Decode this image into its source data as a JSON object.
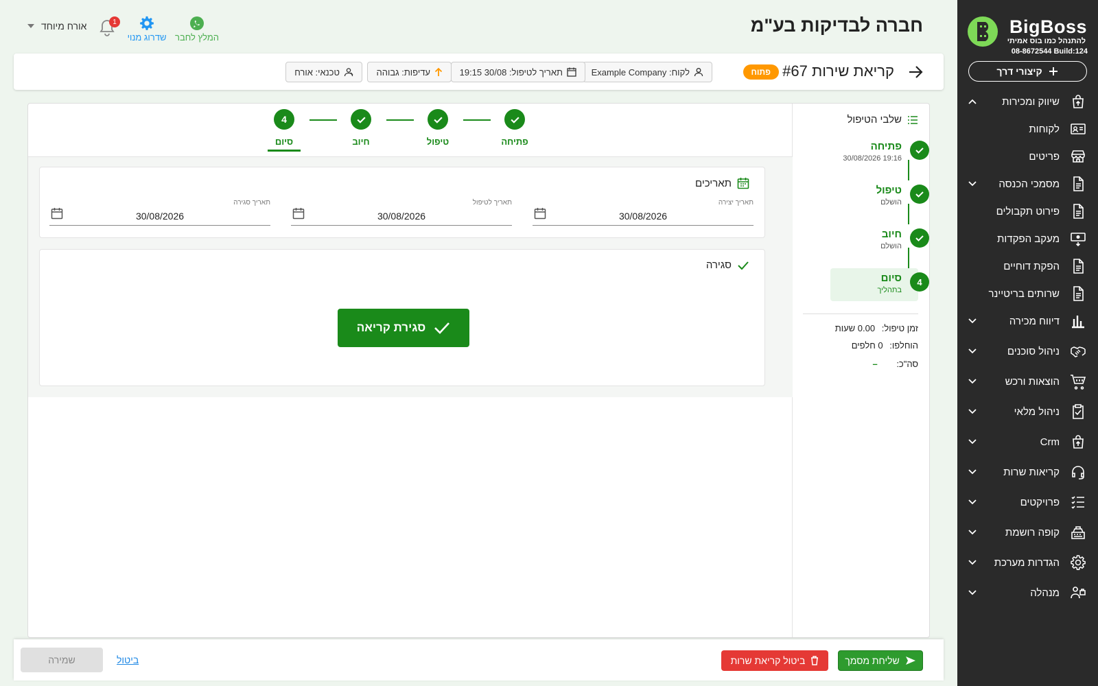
{
  "header": {
    "company_title": "חברה לבדיקות בע\"מ",
    "user_name": "אורח מיוחד",
    "notifications_count": "1",
    "upgrade_label": "שדרוג מנוי",
    "recommend_label": "המלץ לחבר"
  },
  "sidebar": {
    "logo_name": "BigBoss",
    "logo_slogan": "להתנהל כמו בוס אמיתי",
    "logo_phone_build": "08-8672544 Build:124",
    "shortcut_label": "קיצורי דרך",
    "items": [
      {
        "label": "שיווק ומכירות",
        "icon": "bag-upload-icon",
        "chevron": "up"
      },
      {
        "label": "לקוחות",
        "icon": "contact-card-icon",
        "chevron": ""
      },
      {
        "label": "פריטים",
        "icon": "store-icon",
        "chevron": ""
      },
      {
        "label": "מסמכי הכנסה",
        "icon": "document-icon",
        "chevron": "down"
      },
      {
        "label": "פירוט תקבולים",
        "icon": "document-icon",
        "chevron": ""
      },
      {
        "label": "מעקב הפקדות",
        "icon": "cash-deposit-icon",
        "chevron": ""
      },
      {
        "label": "הפקת דוחיים",
        "icon": "document-icon",
        "chevron": ""
      },
      {
        "label": "שרותים בריטיינר",
        "icon": "document-icon",
        "chevron": ""
      },
      {
        "label": "דיווח מכירה",
        "icon": "bar-chart-icon",
        "chevron": "down"
      },
      {
        "label": "ניהול סוכנים",
        "icon": "handshake-icon",
        "chevron": "down"
      },
      {
        "label": "הוצאות ורכש",
        "icon": "cart-icon",
        "chevron": "down"
      },
      {
        "label": "ניהול מלאי",
        "icon": "clipboard-check-icon",
        "chevron": "down"
      },
      {
        "label": "Crm",
        "icon": "bag-upload-icon",
        "chevron": "down"
      },
      {
        "label": "קריאות שרות",
        "icon": "headset-icon",
        "chevron": "down"
      },
      {
        "label": "פרויקטים",
        "icon": "checklist-icon",
        "chevron": "down"
      },
      {
        "label": "קופה רושמת",
        "icon": "cash-register-icon",
        "chevron": "down"
      },
      {
        "label": "הגדרות מערכת",
        "icon": "gear-icon",
        "chevron": "down"
      },
      {
        "label": "מנהלה",
        "icon": "admin-icon",
        "chevron": "down"
      }
    ]
  },
  "call": {
    "title": "קריאת שירות #67",
    "status": "פתוח",
    "customer_chip": "לקוח: Example Company",
    "treatment_date_chip": "תאריך לטיפול: 30/08 19:15",
    "priority_chip": "עדיפות: גבוהה",
    "technician_chip": "טכנאי: אורח"
  },
  "steps_panel": {
    "title": "שלבי הטיפול",
    "steps": [
      {
        "name": "פתיחה",
        "sub": "30/08/2026 19:16",
        "circle": ""
      },
      {
        "name": "טיפול",
        "sub": "הושלם",
        "circle": ""
      },
      {
        "name": "חיוב",
        "sub": "הושלם",
        "circle": ""
      },
      {
        "name": "סיום",
        "sub": "בתהליך",
        "circle": "4"
      }
    ],
    "summary": {
      "time_label": "זמן טיפול:",
      "time_value": "0.00 שעות",
      "parts_label": "הוחלפו:",
      "parts_value": "0 חלפים",
      "total_label": "סה\"כ:",
      "total_value": "–"
    }
  },
  "stepper": {
    "steps": [
      {
        "label": "פתיחה",
        "circle": ""
      },
      {
        "label": "טיפול",
        "circle": ""
      },
      {
        "label": "חיוב",
        "circle": ""
      },
      {
        "label": "סיום",
        "circle": "4"
      }
    ]
  },
  "dates": {
    "title": "תאריכים",
    "created_label": "תאריך יצירה",
    "created_value": "30/08/2026",
    "treatment_label": "תאריך לטיפול",
    "treatment_value": "30/08/2026",
    "closing_label": "תאריך סגירה",
    "closing_value": "30/08/2026"
  },
  "closing": {
    "title": "סגירה",
    "close_button": "סגירת קריאה"
  },
  "footer": {
    "send_doc": "שליחת מסמך",
    "cancel_call": "ביטול קריאת שרות",
    "cancel": "ביטול",
    "save": "שמירה"
  },
  "colors": {
    "primary_green": "#1a8a1a",
    "status_orange": "#ff9800",
    "danger_red": "#e53935",
    "sidebar_bg": "#2a2a2a"
  }
}
